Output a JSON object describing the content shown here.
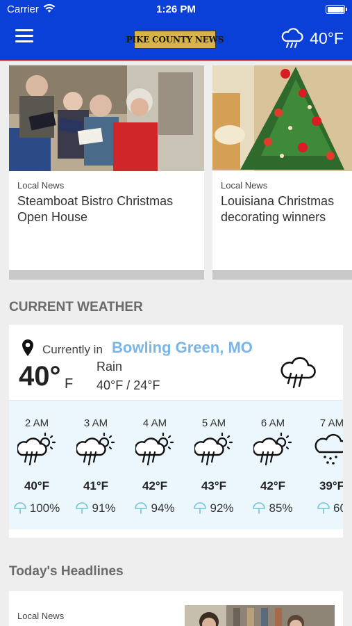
{
  "status": {
    "carrier": "Carrier",
    "time": "1:26 PM"
  },
  "header": {
    "logo_text": "PIKE COUNTY NEWS",
    "weather_temp": "40°F"
  },
  "stories": [
    {
      "category": "Local News",
      "title": "Steamboat Bistro  Christmas Open House"
    },
    {
      "category": "Local News",
      "title": "Louisiana Christmas decorating winners"
    }
  ],
  "weather": {
    "section_title": "CURRENT WEATHER",
    "currently_label": "Currently in",
    "location": "Bowling Green, MO",
    "temp": "40°",
    "unit": "F",
    "condition": "Rain",
    "range": "40°F / 24°F",
    "hourly": [
      {
        "time": "2 AM",
        "temp": "40°F",
        "precip": "100%",
        "icon": "cloud-sun-rain-icon"
      },
      {
        "time": "3 AM",
        "temp": "41°F",
        "precip": "91%",
        "icon": "cloud-sun-rain-icon"
      },
      {
        "time": "4 AM",
        "temp": "42°F",
        "precip": "94%",
        "icon": "cloud-sun-rain-icon"
      },
      {
        "time": "5 AM",
        "temp": "43°F",
        "precip": "92%",
        "icon": "cloud-sun-rain-icon"
      },
      {
        "time": "6 AM",
        "temp": "42°F",
        "precip": "85%",
        "icon": "cloud-sun-rain-icon"
      },
      {
        "time": "7 AM",
        "temp": "39°F",
        "precip": "60",
        "icon": "cloud-snow-icon"
      }
    ]
  },
  "headlines": {
    "section_title": "Today's Headlines",
    "first_category": "Local News"
  },
  "colors": {
    "header": "#0a3fd8",
    "location_link": "#7ab5e8",
    "hourly_bg": "#ebf6fd"
  }
}
